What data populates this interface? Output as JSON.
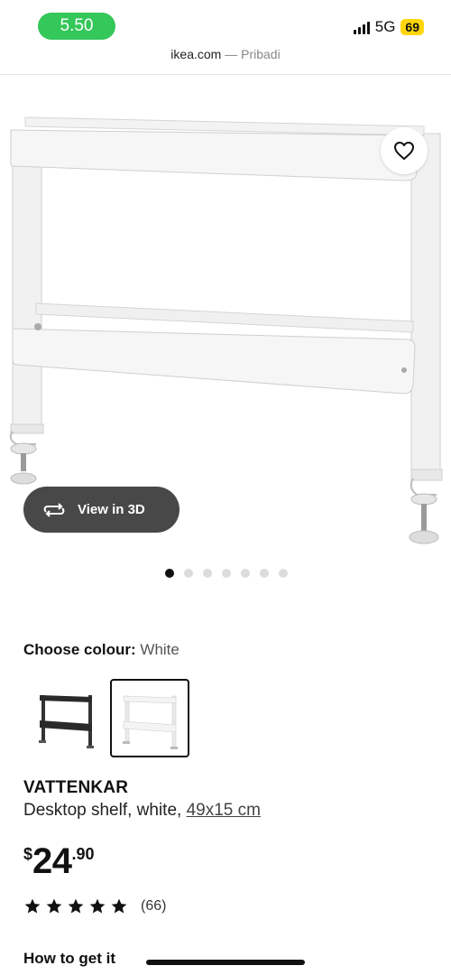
{
  "status_bar": {
    "time": "5.50",
    "network": "5G",
    "battery": "69"
  },
  "browser": {
    "domain": "ikea.com",
    "separator": "—",
    "site_name": "Pribadi"
  },
  "gallery": {
    "view_3d_label": "View in 3D",
    "image_count": 7,
    "active_index": 0
  },
  "colour_chooser": {
    "label": "Choose colour:",
    "selected": "White",
    "options": [
      "black",
      "white"
    ]
  },
  "product": {
    "name": "VATTENKAR",
    "description": "Desktop shelf, white,",
    "dimensions": "49x15 cm",
    "price_currency": "$",
    "price_integer": "24",
    "price_decimal": ".90",
    "rating_stars": 5,
    "review_count": "(66)"
  },
  "sections": {
    "how_to_get_it": "How to get it"
  },
  "colors": {
    "time_pill": "#34c759",
    "battery": "#ffd60a",
    "view3d_button": "#484848"
  }
}
